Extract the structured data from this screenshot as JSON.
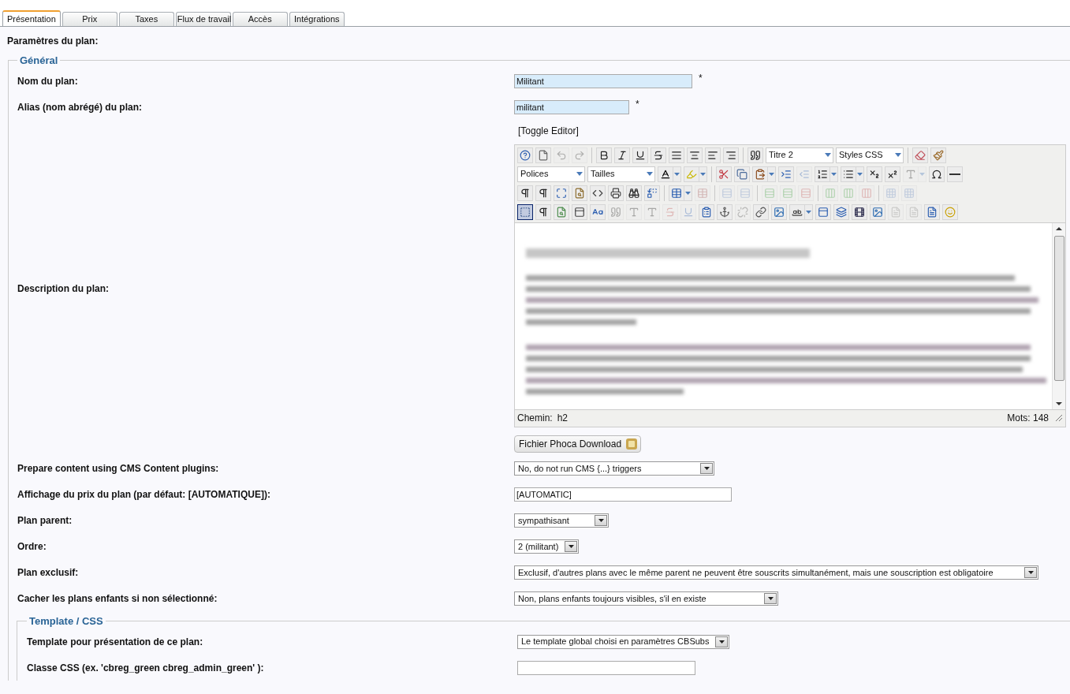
{
  "tabs": [
    {
      "label": "Présentation",
      "selected": true
    },
    {
      "label": "Prix",
      "selected": false
    },
    {
      "label": "Taxes",
      "selected": false
    },
    {
      "label": "Flux de travail",
      "selected": false
    },
    {
      "label": "Accès",
      "selected": false
    },
    {
      "label": "Intégrations",
      "selected": false
    }
  ],
  "section_title": "Paramètres du plan:",
  "general": {
    "legend": "Général",
    "rows": [
      {
        "kind": "input",
        "label": "Nom du plan:",
        "value": "Militant",
        "highlight": true,
        "required": "*"
      },
      {
        "kind": "input",
        "label": "Alias (nom abrégé) du plan:",
        "value": "militant",
        "highlight": true,
        "required": "*"
      },
      {
        "kind": "editor",
        "label": "Description du plan:",
        "toggle": "[Toggle Editor]",
        "path_label": "Chemin:",
        "path": "h2",
        "words": "Mots: 148",
        "button": "Fichier Phoca Download",
        "toolbar": [
          [
            {
              "kind": "button",
              "disabled": false,
              "on": false
            },
            {
              "kind": "button",
              "disabled": false,
              "on": false
            },
            {
              "kind": "button",
              "disabled": true,
              "on": false
            },
            {
              "kind": "button",
              "disabled": true,
              "on": false
            },
            {
              "kind": "separator"
            },
            {
              "kind": "button",
              "disabled": false,
              "on": false
            },
            {
              "kind": "button",
              "disabled": false,
              "on": false
            },
            {
              "kind": "button",
              "disabled": false,
              "on": false
            },
            {
              "kind": "button",
              "disabled": false,
              "on": false
            },
            {
              "kind": "button",
              "disabled": false,
              "on": false
            },
            {
              "kind": "button",
              "disabled": false,
              "on": false
            },
            {
              "kind": "button",
              "disabled": false,
              "on": false
            },
            {
              "kind": "button",
              "disabled": false,
              "on": false
            },
            {
              "kind": "separator"
            },
            {
              "kind": "button",
              "disabled": false,
              "on": false
            },
            {
              "kind": "select",
              "value": "Titre 2"
            },
            {
              "kind": "select",
              "value": "Styles CSS"
            },
            {
              "kind": "separator"
            },
            {
              "kind": "button",
              "disabled": false,
              "on": false
            },
            {
              "kind": "button",
              "disabled": false,
              "on": false
            }
          ],
          [
            {
              "kind": "select",
              "value": "Polices"
            },
            {
              "kind": "select",
              "value": "Tailles"
            },
            {
              "kind": "split",
              "disabled": false,
              "on": false
            },
            {
              "kind": "split",
              "disabled": false,
              "on": false
            },
            {
              "kind": "separator"
            },
            {
              "kind": "button",
              "disabled": false,
              "on": false
            },
            {
              "kind": "button",
              "disabled": false,
              "on": false
            },
            {
              "kind": "split",
              "disabled": false,
              "on": false
            },
            {
              "kind": "button",
              "disabled": false,
              "on": false
            },
            {
              "kind": "button",
              "disabled": true,
              "on": false
            },
            {
              "kind": "split",
              "disabled": false,
              "on": false
            },
            {
              "kind": "split",
              "disabled": false,
              "on": false
            },
            {
              "kind": "button",
              "disabled": false,
              "on": false
            },
            {
              "kind": "button",
              "disabled": false,
              "on": false
            },
            {
              "kind": "split",
              "disabled": true,
              "on": false
            },
            {
              "kind": "button",
              "disabled": false,
              "on": false
            },
            {
              "kind": "button",
              "disabled": false,
              "on": false
            }
          ],
          [
            {
              "kind": "button",
              "disabled": false,
              "on": false
            },
            {
              "kind": "button",
              "disabled": false,
              "on": false
            },
            {
              "kind": "button",
              "disabled": false,
              "on": false
            },
            {
              "kind": "button",
              "disabled": false,
              "on": false
            },
            {
              "kind": "button",
              "disabled": false,
              "on": false
            },
            {
              "kind": "button",
              "disabled": false,
              "on": false
            },
            {
              "kind": "button",
              "disabled": false,
              "on": false
            },
            {
              "kind": "button",
              "disabled": false,
              "on": false
            },
            {
              "kind": "separator"
            },
            {
              "kind": "split",
              "disabled": false,
              "on": false
            },
            {
              "kind": "button",
              "disabled": true,
              "on": false
            },
            {
              "kind": "separator"
            },
            {
              "kind": "button",
              "disabled": true,
              "on": false
            },
            {
              "kind": "button",
              "disabled": true,
              "on": false
            },
            {
              "kind": "separator"
            },
            {
              "kind": "button",
              "disabled": true,
              "on": false
            },
            {
              "kind": "button",
              "disabled": true,
              "on": false
            },
            {
              "kind": "button",
              "disabled": true,
              "on": false
            },
            {
              "kind": "separator"
            },
            {
              "kind": "button",
              "disabled": true,
              "on": false
            },
            {
              "kind": "button",
              "disabled": true,
              "on": false
            },
            {
              "kind": "button",
              "disabled": true,
              "on": false
            },
            {
              "kind": "separator"
            },
            {
              "kind": "button",
              "disabled": true,
              "on": false
            },
            {
              "kind": "button",
              "disabled": true,
              "on": false
            }
          ],
          [
            {
              "kind": "button",
              "disabled": false,
              "on": true
            },
            {
              "kind": "button",
              "disabled": false,
              "on": false
            },
            {
              "kind": "button",
              "disabled": false,
              "on": false
            },
            {
              "kind": "button",
              "disabled": false,
              "on": false
            },
            {
              "kind": "button",
              "disabled": false,
              "on": false
            },
            {
              "kind": "button",
              "disabled": true,
              "on": false
            },
            {
              "kind": "button",
              "disabled": true,
              "on": false
            },
            {
              "kind": "button",
              "disabled": true,
              "on": false
            },
            {
              "kind": "button",
              "disabled": true,
              "on": false
            },
            {
              "kind": "button",
              "disabled": true,
              "on": false
            },
            {
              "kind": "button",
              "disabled": false,
              "on": false
            },
            {
              "kind": "button",
              "disabled": false,
              "on": false
            },
            {
              "kind": "button",
              "disabled": true,
              "on": false
            },
            {
              "kind": "button",
              "disabled": false,
              "on": false
            },
            {
              "kind": "button",
              "disabled": false,
              "on": false
            },
            {
              "kind": "split",
              "disabled": false,
              "on": false
            },
            {
              "kind": "button",
              "disabled": false,
              "on": false
            },
            {
              "kind": "button",
              "disabled": false,
              "on": false
            },
            {
              "kind": "button",
              "disabled": false,
              "on": false
            },
            {
              "kind": "button",
              "disabled": false,
              "on": false
            },
            {
              "kind": "button",
              "disabled": true,
              "on": false
            },
            {
              "kind": "button",
              "disabled": true,
              "on": false
            },
            {
              "kind": "button",
              "disabled": false,
              "on": false
            },
            {
              "kind": "button",
              "disabled": false,
              "on": false
            }
          ]
        ]
      },
      {
        "kind": "select",
        "label": "Prepare content using CMS Content plugins:",
        "value": "No, do not run CMS {...} triggers"
      },
      {
        "kind": "input",
        "label": "Affichage du prix du plan (par défaut: [AUTOMATIQUE]):",
        "value": "[AUTOMATIC]",
        "highlight": false
      },
      {
        "kind": "select",
        "label": "Plan parent:",
        "value": "sympathisant"
      },
      {
        "kind": "select",
        "label": "Ordre:",
        "value": "2 (militant)"
      },
      {
        "kind": "select",
        "label": "Plan exclusif:",
        "value": "Exclusif, d'autres plans avec le même parent ne peuvent être souscrits simultanément, mais une souscription est obligatoire"
      },
      {
        "kind": "select",
        "label": "Cacher les plans enfants si non sélectionné:",
        "value": "Non, plans enfants toujours visibles, s'il en existe"
      }
    ]
  },
  "template_css": {
    "legend": "Template / CSS",
    "rows": [
      {
        "kind": "select",
        "label": "Template pour présentation de ce plan:",
        "value": "Le template global choisi en paramètres CBSubs"
      },
      {
        "kind": "input",
        "label": "Classe CSS (ex. 'cbreg_green cbreg_admin_green' ):",
        "value": "",
        "highlight": false
      }
    ]
  }
}
